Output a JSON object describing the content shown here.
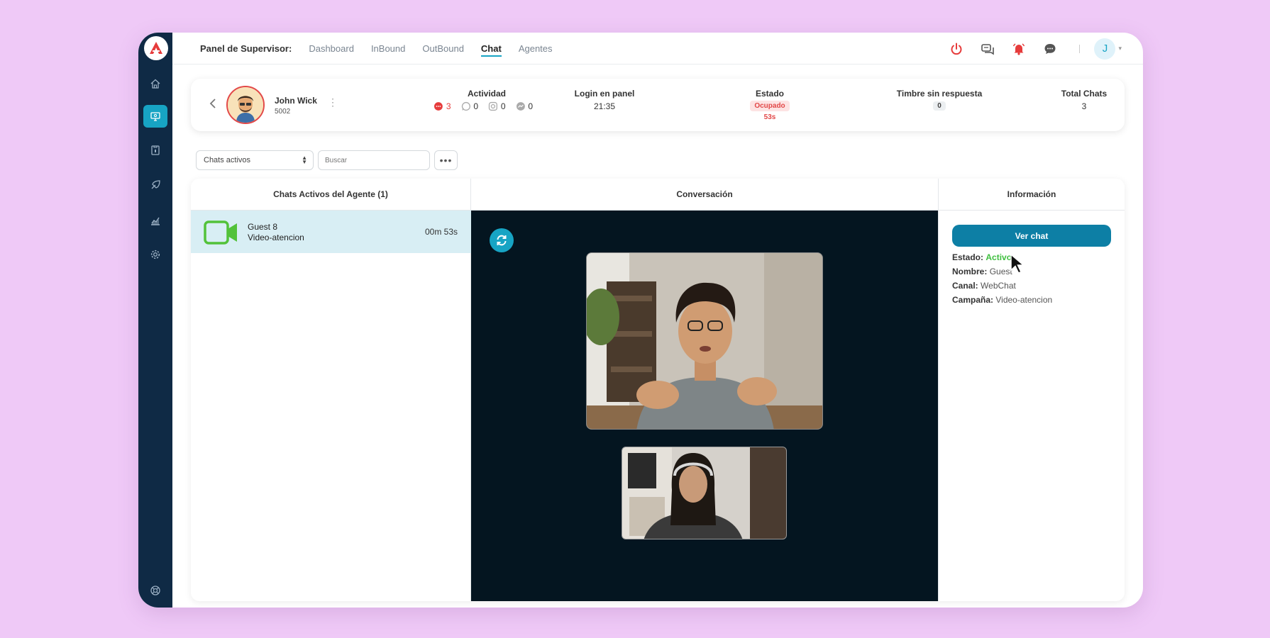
{
  "header": {
    "panel_title": "Panel de Supervisor:",
    "tabs": [
      {
        "label": "Dashboard",
        "active": false
      },
      {
        "label": "InBound",
        "active": false
      },
      {
        "label": "OutBound",
        "active": false
      },
      {
        "label": "Chat",
        "active": true
      },
      {
        "label": "Agentes",
        "active": false
      }
    ],
    "user_initial": "J",
    "icons": [
      "power-icon",
      "chat-bubbles-icon",
      "bell-icon",
      "message-icon"
    ]
  },
  "sidebar": {
    "icons": [
      "home-icon",
      "monitor-icon",
      "contacts-icon",
      "campaign-icon",
      "reports-icon",
      "settings-icon",
      "help-icon"
    ],
    "active": "monitor-icon"
  },
  "agent": {
    "name": "John Wick",
    "extension": "5002",
    "actividad_label": "Actividad",
    "activity": {
      "chat": "3",
      "whatsapp": "0",
      "instagram": "0",
      "messenger": "0"
    },
    "login_label": "Login en panel",
    "login_value": "21:35",
    "estado_label": "Estado",
    "estado_value": "Ocupado",
    "estado_time": "53s",
    "timbre_label": "Timbre sin respuesta",
    "timbre_value": "0",
    "total_label": "Total Chats",
    "total_value": "3"
  },
  "filters": {
    "select_value": "Chats activos",
    "search_placeholder": "Buscar",
    "more_label": "•••"
  },
  "columns": {
    "left_title": "Chats Activos del Agente (1)",
    "middle_title": "Conversación",
    "right_title": "Información"
  },
  "chats": [
    {
      "name": "Guest 8",
      "campaign": "Video-atencion",
      "time": "00m 53s"
    }
  ],
  "info": {
    "button_label": "Ver chat",
    "estado_label": "Estado:",
    "estado_value": "Activo",
    "nombre_label": "Nombre:",
    "nombre_value": "Guest",
    "canal_label": "Canal:",
    "canal_value": "WebChat",
    "campana_label": "Campaña:",
    "campana_value": "Video-atencion"
  },
  "colors": {
    "accent": "#17a4c4",
    "sidebar": "#0f2a45",
    "busy": "#e24848",
    "active": "#3fbf3f",
    "video_bg": "#041520",
    "button": "#0d7fa5"
  }
}
